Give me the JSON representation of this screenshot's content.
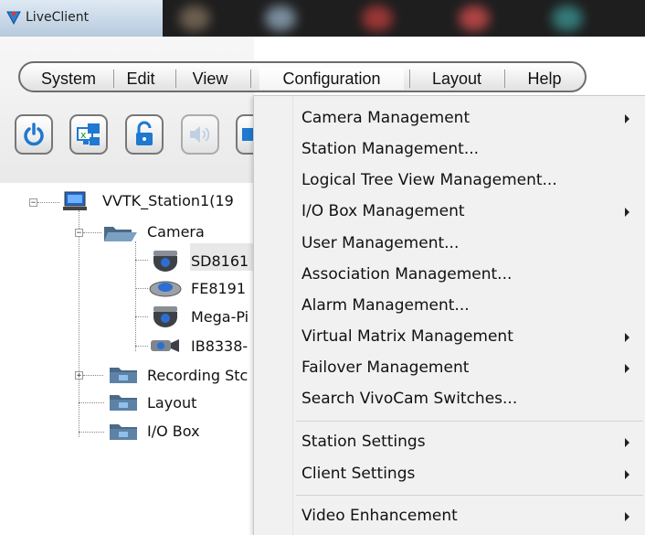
{
  "window": {
    "title": "LiveClient"
  },
  "menubar": {
    "items": [
      "System",
      "Edit",
      "View",
      "Configuration",
      "Layout",
      "Help"
    ],
    "active": "Configuration"
  },
  "toolbar": {
    "buttons": [
      {
        "icon": "power-icon",
        "enabled": true
      },
      {
        "icon": "remote-desktop-icon",
        "enabled": true
      },
      {
        "icon": "unlock-icon",
        "enabled": true
      },
      {
        "icon": "speaker-icon",
        "enabled": false
      }
    ]
  },
  "tree": {
    "station": "VVTK_Station1(19",
    "camera_folder": "Camera",
    "cameras": [
      "SD8161",
      "FE8191",
      "Mega-Pi",
      "IB8338-"
    ],
    "recording": "Recording Stc",
    "layout": "Layout",
    "io_box": "I/O Box"
  },
  "dropdown": {
    "items": [
      {
        "label": "Camera Management",
        "submenu": true
      },
      {
        "label": "Station Management...",
        "submenu": false
      },
      {
        "label": "Logical Tree View Management...",
        "submenu": false
      },
      {
        "label": "I/O Box Management",
        "submenu": true
      },
      {
        "label": "User Management...",
        "submenu": false
      },
      {
        "label": "Association Management...",
        "submenu": false
      },
      {
        "label": "Alarm Management...",
        "submenu": false
      },
      {
        "label": "Virtual Matrix Management",
        "submenu": true
      },
      {
        "label": "Failover Management",
        "submenu": true
      },
      {
        "label": "Search VivoCam Switches...",
        "submenu": false
      },
      {
        "label": "Station Settings",
        "submenu": true
      },
      {
        "label": "Client Settings",
        "submenu": true
      },
      {
        "label": "Video Enhancement",
        "submenu": true
      }
    ]
  },
  "colors": {
    "menu_border": "#6d6d6d",
    "dropdown_bg": "#f1f1f1",
    "titlebar": "#1e1e1e"
  }
}
